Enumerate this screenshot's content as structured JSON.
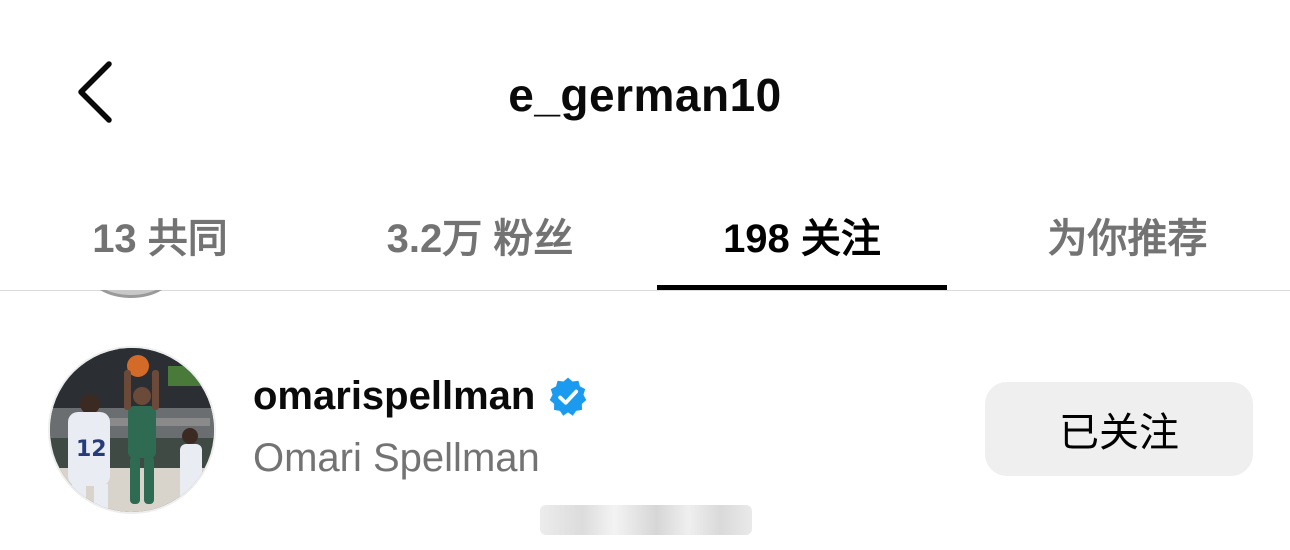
{
  "header": {
    "title": "e_german10",
    "back_icon": "chevron-left-icon"
  },
  "tabs": [
    {
      "label": "13 共同",
      "active": false
    },
    {
      "label": "3.2万 粉丝",
      "active": false
    },
    {
      "label": "198 关注",
      "active": true
    },
    {
      "label": "为你推荐",
      "active": false
    }
  ],
  "list": {
    "items": [
      {
        "username": "omarispellman",
        "full_name": "Omari Spellman",
        "verified": true,
        "verified_icon": "verified-badge-icon",
        "button_label": "已关注",
        "avatar_icon": "avatar-photo"
      }
    ]
  },
  "colors": {
    "accent_verified": "#1a9bf0",
    "muted_text": "#737373",
    "button_bg": "#efefef",
    "active_tab_indicator": "#000000"
  }
}
